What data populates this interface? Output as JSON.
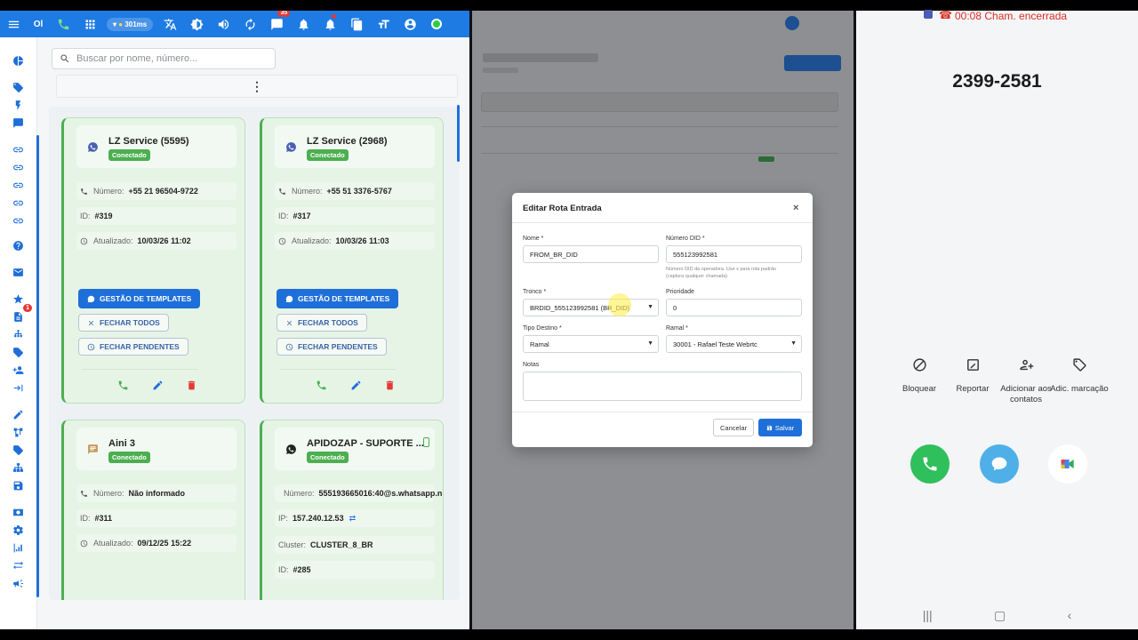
{
  "topbar": {
    "brand_short": "Ol",
    "ping": "301ms",
    "chat_badge": "35"
  },
  "search": {
    "placeholder": "Buscar por nome, número..."
  },
  "kebab": "⋮",
  "cards": [
    {
      "title": "LZ Service (5595)",
      "status": "Conectado",
      "number_label": "Número:",
      "number": "+55 21 96504-9722",
      "id_label": "ID:",
      "id": "#319",
      "updated_label": "Atualizado:",
      "updated": "10/03/26 11:02",
      "btn_templates": "GESTÃO DE TEMPLATES",
      "btn_close_all": "FECHAR TODOS",
      "btn_close_pending": "FECHAR PENDENTES"
    },
    {
      "title": "LZ Service (2968)",
      "status": "Conectado",
      "number_label": "Número:",
      "number": "+55 51 3376-5767",
      "id_label": "ID:",
      "id": "#317",
      "updated_label": "Atualizado:",
      "updated": "10/03/26 11:03",
      "btn_templates": "GESTÃO DE TEMPLATES",
      "btn_close_all": "FECHAR TODOS",
      "btn_close_pending": "FECHAR PENDENTES"
    },
    {
      "title": "Aini 3",
      "status": "Conectado",
      "number_label": "Número:",
      "number": "Não informado",
      "id_label": "ID:",
      "id": "#311",
      "updated_label": "Atualizado:",
      "updated": "09/12/25 15:22"
    },
    {
      "title": "APIDOZAP - SUPORTE ...",
      "status": "Conectado",
      "number_label": "Número:",
      "number": "555193665016:40@s.whatsapp.n",
      "ip_label": "IP:",
      "ip": "157.240.12.53",
      "cluster_label": "Cluster:",
      "cluster": "CLUSTER_8_BR",
      "id_label": "ID:",
      "id": "#285"
    }
  ],
  "modal": {
    "title": "Editar Rota Entrada",
    "close": "×",
    "nome_label": "Nome *",
    "nome_value": "FROM_BR_DID",
    "did_label": "Número DID *",
    "did_value": "555123992581",
    "did_hint_1": "Número DID da operadora. Use x para rota padrão",
    "did_hint_2": "(captura qualquer chamada)",
    "tronco_label": "Tronco *",
    "tronco_value": "BRDID_555123992581 (BR_DID)",
    "prioridade_label": "Prioridade",
    "prioridade_value": "0",
    "tipo_label": "Tipo Destino *",
    "tipo_value": "Ramal",
    "ramal_label": "Ramal *",
    "ramal_value": "30001 - Rafael Teste Webrtc",
    "notas_label": "Notas",
    "cancel": "Cancelar",
    "save": "Salvar"
  },
  "phone": {
    "call_status": "00:08  Cham. encerrada",
    "number": "2399-2581",
    "actions": [
      {
        "label": "Bloquear",
        "icon": "block-icon"
      },
      {
        "label": "Reportar",
        "icon": "report-icon"
      },
      {
        "label": "Adicionar aos contatos",
        "icon": "add-contact-icon"
      },
      {
        "label": "Adic. marcação",
        "icon": "tag-icon"
      }
    ],
    "colors": {
      "call": "#2fbf5b",
      "message": "#4fb0e8"
    }
  }
}
